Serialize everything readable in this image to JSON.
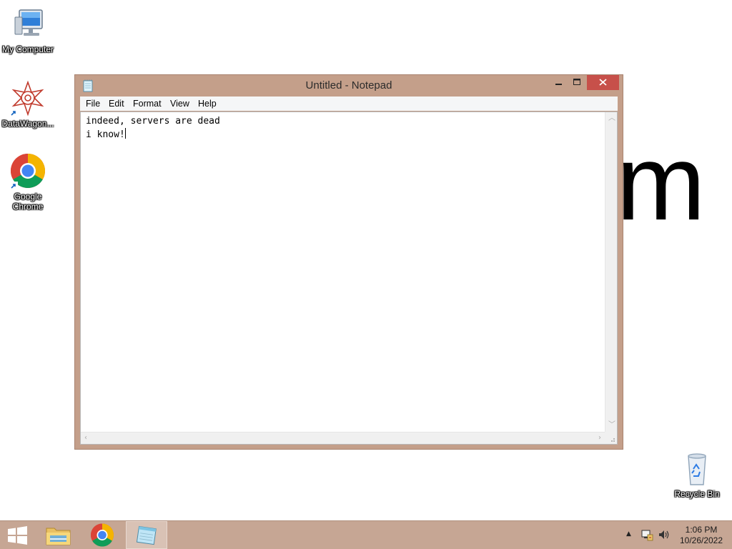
{
  "desktop": {
    "background_glyph": "m",
    "icons": [
      {
        "label": "My Computer",
        "icon": "computer-icon"
      },
      {
        "label": "DataWagon...",
        "icon": "datawagon-icon"
      },
      {
        "label": "Google Chrome",
        "icon": "chrome-icon"
      },
      {
        "label": "Recycle Bin",
        "icon": "recycle-bin-icon"
      }
    ]
  },
  "window": {
    "title": "Untitled - Notepad",
    "controls": {
      "minimize": "—",
      "maximize": "□",
      "close": "✕"
    },
    "menu": [
      "File",
      "Edit",
      "Format",
      "View",
      "Help"
    ],
    "content_lines": [
      "indeed, servers are dead",
      "i know!"
    ]
  },
  "taskbar": {
    "items": [
      {
        "name": "start-button",
        "icon": "windows-logo-icon"
      },
      {
        "name": "file-explorer",
        "icon": "folder-icon"
      },
      {
        "name": "chrome",
        "icon": "chrome-icon"
      },
      {
        "name": "notepad",
        "icon": "notepad-icon",
        "active": true
      }
    ],
    "tray": {
      "time": "1:06 PM",
      "date": "10/26/2022"
    }
  },
  "colors": {
    "window_frame": "#c49f8a",
    "close_button": "#c7504a",
    "taskbar": "#c6a694"
  }
}
